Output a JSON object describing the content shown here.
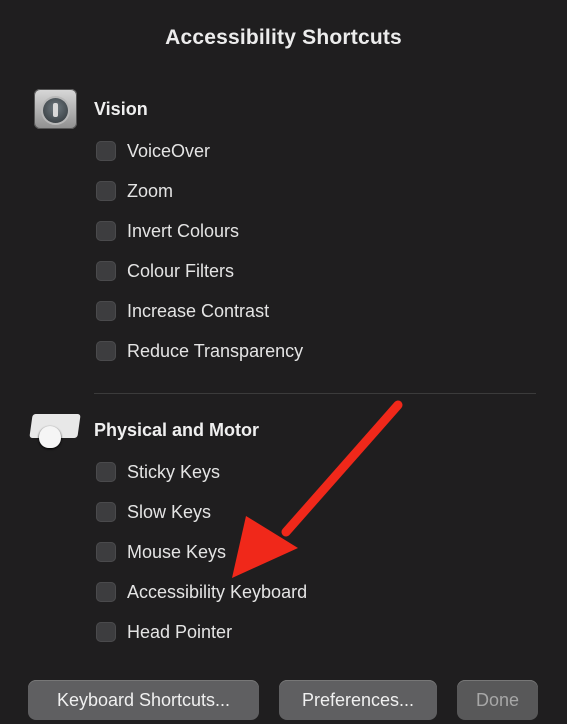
{
  "dialog": {
    "title": "Accessibility Shortcuts"
  },
  "sections": {
    "vision": {
      "label": "Vision",
      "icon": "vision-accessibility-icon",
      "items": [
        {
          "label": "VoiceOver",
          "checked": false
        },
        {
          "label": "Zoom",
          "checked": false
        },
        {
          "label": "Invert Colours",
          "checked": false
        },
        {
          "label": "Colour Filters",
          "checked": false
        },
        {
          "label": "Increase Contrast",
          "checked": false
        },
        {
          "label": "Reduce Transparency",
          "checked": false
        }
      ]
    },
    "motor": {
      "label": "Physical and Motor",
      "icon": "keyboard-mouse-icon",
      "items": [
        {
          "label": "Sticky Keys",
          "checked": false
        },
        {
          "label": "Slow Keys",
          "checked": false
        },
        {
          "label": "Mouse Keys",
          "checked": false
        },
        {
          "label": "Accessibility Keyboard",
          "checked": false
        },
        {
          "label": "Head Pointer",
          "checked": false
        }
      ]
    }
  },
  "buttons": {
    "keyboard_shortcuts": "Keyboard Shortcuts...",
    "preferences": "Preferences...",
    "done": "Done"
  },
  "annotation": {
    "arrow_color": "#f0281a",
    "points_to": "Accessibility Keyboard"
  },
  "colors": {
    "background": "#1f1e1f",
    "button": "#5f5f61",
    "checkbox": "#3d3d3f"
  }
}
